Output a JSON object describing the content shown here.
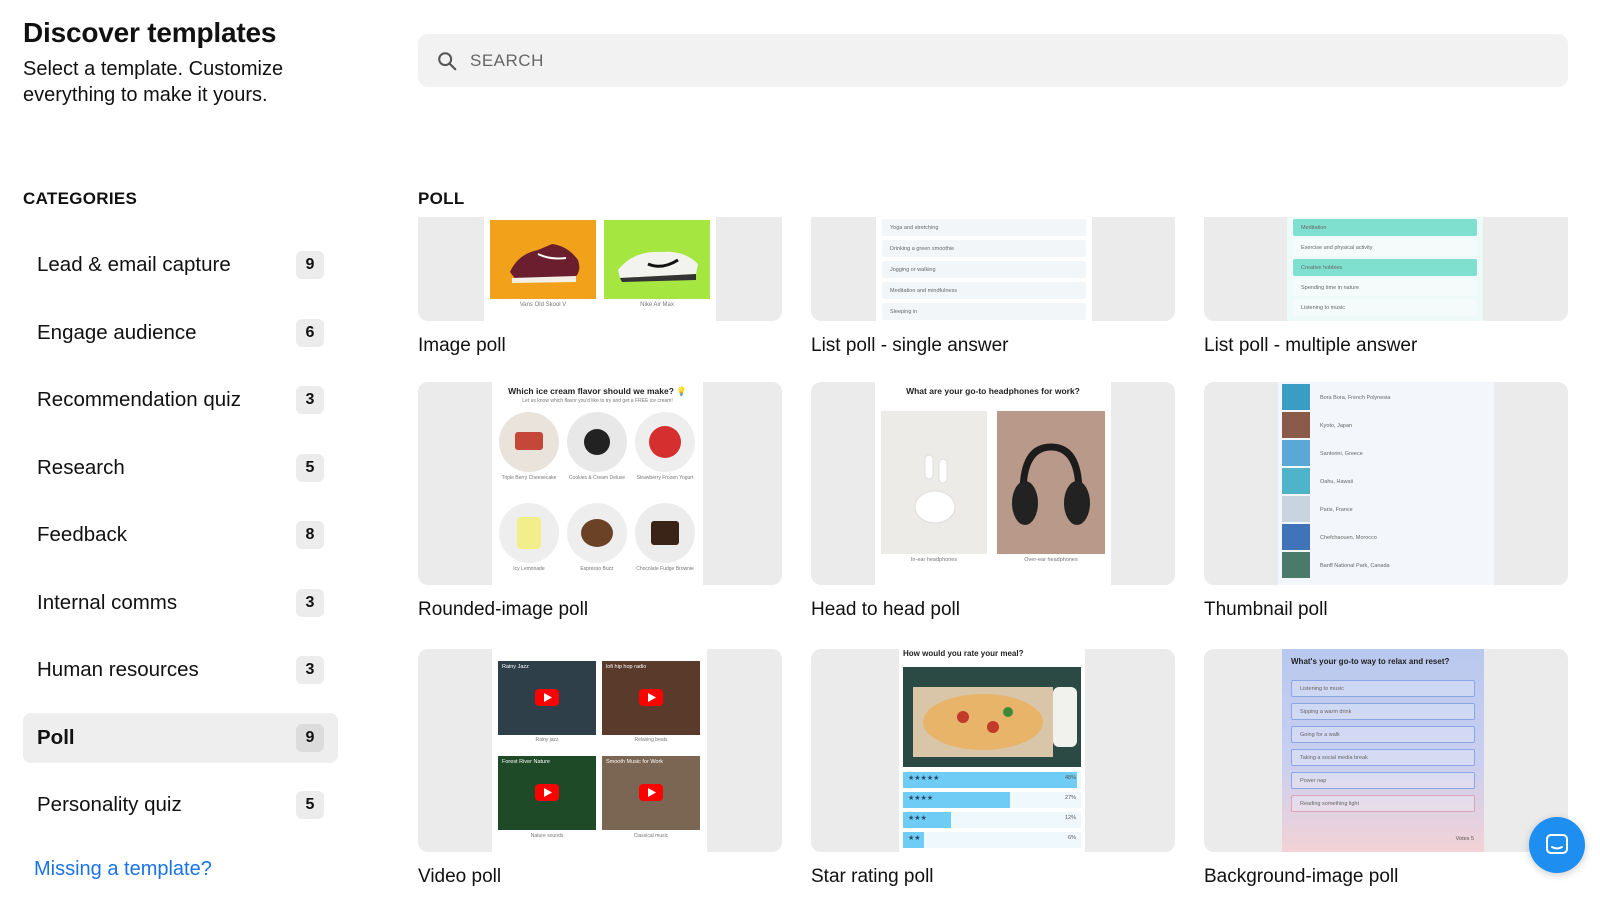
{
  "header": {
    "title": "Discover templates",
    "subtitle": "Select a template. Customize everything to make it yours."
  },
  "search": {
    "placeholder": "SEARCH"
  },
  "sidebar": {
    "heading": "CATEGORIES",
    "items": [
      {
        "label": "Lead & email capture",
        "count": "9"
      },
      {
        "label": "Engage audience",
        "count": "6"
      },
      {
        "label": "Recommendation quiz",
        "count": "3"
      },
      {
        "label": "Research",
        "count": "5"
      },
      {
        "label": "Feedback",
        "count": "8"
      },
      {
        "label": "Internal comms",
        "count": "3"
      },
      {
        "label": "Human resources",
        "count": "3"
      },
      {
        "label": "Poll",
        "count": "9",
        "active": true
      },
      {
        "label": "Personality quiz",
        "count": "5"
      }
    ],
    "missing_link": "Missing a template?"
  },
  "section": {
    "title": "POLL"
  },
  "templates": [
    {
      "label": "Image poll",
      "preview": {
        "options": [
          "Vans Old Skool V",
          "Nike Air Max"
        ]
      }
    },
    {
      "label": "List poll - single answer",
      "preview": {
        "options": [
          "Yoga and stretching",
          "Drinking a green smoothie",
          "Jogging or walking",
          "Meditation and mindfulness",
          "Sleeping in"
        ]
      }
    },
    {
      "label": "List poll - multiple answer",
      "preview": {
        "options": [
          "Meditation",
          "Exercise and physical activity",
          "Creative hobbies",
          "Spending time in nature",
          "Listening to music"
        ]
      }
    },
    {
      "label": "Rounded-image poll",
      "preview": {
        "title": "Which ice cream flavor should we make? 💡",
        "subtitle": "Let us know which flavor you'd like to try and get a FREE ice cream!",
        "options": [
          "Triple Berry Cheesecake",
          "Cookies & Cream Deluxe",
          "Strawberry Frozen Yogurt",
          "Icy Lemonade",
          "Espresso Buzz",
          "Chocolate Fudge Brownie"
        ]
      }
    },
    {
      "label": "Head to head poll",
      "preview": {
        "title": "What are your go-to headphones for work?",
        "options": [
          "In-ear headphones",
          "Over-ear headphones"
        ]
      }
    },
    {
      "label": "Thumbnail poll",
      "preview": {
        "options": [
          "Bora Bora, French Polynesia",
          "Kyoto, Japan",
          "Santorini, Greece",
          "Oahu, Hawaii",
          "Paris, France",
          "Chefchaouen, Morocco",
          "Banff National Park, Canada"
        ]
      }
    },
    {
      "label": "Video poll",
      "preview": {
        "videos": [
          "Rainy Jazz",
          "lofi hip hop radio",
          "Forest River Nature",
          "Smooth Music for Work"
        ],
        "options": [
          "Rainy jazz",
          "Relaxing beats",
          "Nature sounds",
          "Classical music"
        ]
      }
    },
    {
      "label": "Star rating poll",
      "preview": {
        "title": "How would you rate your meal?",
        "ratings": [
          {
            "stars": "★★★★★",
            "pct": "48%",
            "value": 0.98
          },
          {
            "stars": "★★★★",
            "pct": "27%",
            "value": 0.6
          },
          {
            "stars": "★★★",
            "pct": "12%",
            "value": 0.27
          },
          {
            "stars": "★★",
            "pct": "6%",
            "value": 0.12
          }
        ]
      }
    },
    {
      "label": "Background-image poll",
      "preview": {
        "title": "What's your go-to way to relax and reset?",
        "options": [
          "Listening to music",
          "Sipping a warm drink",
          "Going for a walk",
          "Taking a social media break",
          "Power nap",
          "Reading something light"
        ],
        "votes": "Votes 5"
      }
    }
  ],
  "colors": {
    "link": "#1a73e8",
    "chat": "#1f8ef1",
    "poll_highlight": "#7fe0d0",
    "rating_bar": "#6fcdf5"
  }
}
